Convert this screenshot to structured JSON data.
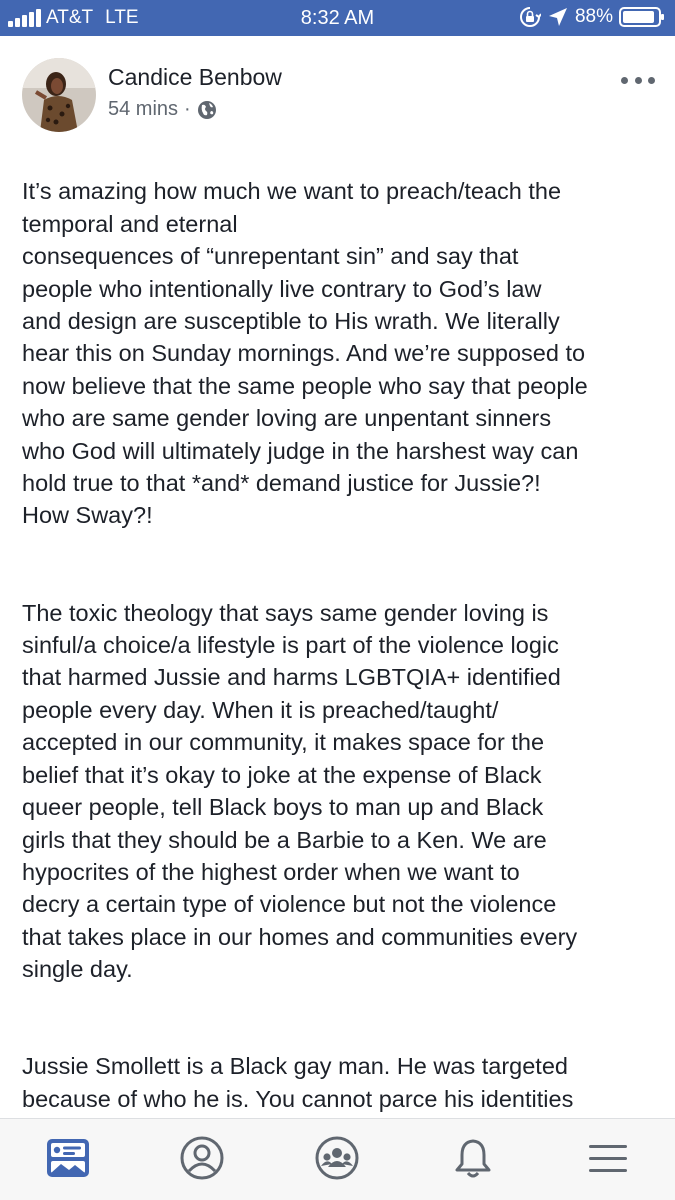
{
  "status_bar": {
    "carrier": "AT&T",
    "network": "LTE",
    "time": "8:32 AM",
    "battery": "88%"
  },
  "post": {
    "author": "Candice Benbow",
    "time_ago": "54 mins",
    "separator": "·",
    "privacy_icon": "globe-icon",
    "paragraphs": [
      "It’s amazing how much we want to preach/teach the\ntemporal and eternal\nconsequences of “unrepentant sin” and say that\npeople who intentionally live contrary to  God’s law\nand design are susceptible to His wrath. We literally\nhear this on Sunday mornings. And we’re supposed to\nnow believe that the same people who say that people\nwho are same gender loving are unpentant sinners\nwho God will ultimately judge in the harshest way can\nhold true to that *and* demand justice for Jussie?!\nHow Sway?!",
      "The toxic theology that says same gender loving is\nsinful/a choice/a lifestyle is part of the violence logic\nthat harmed Jussie and harms LGBTQIA+ identified\npeople every day. When it is preached/taught/\naccepted in our community, it makes space for the\nbelief that it’s okay to joke at the expense of Black\nqueer people, tell Black boys to man up and Black\ngirls that they should be a Barbie to a  Ken. We are\nhypocrites of the highest order when we want to\ndecry a certain type of violence but not the violence\nthat takes place in our homes and communities every\nsingle day.",
      "Jussie Smollett is a Black gay man. He was targeted\nbecause of who he is. You cannot parce his identities\nbecause you want to condemn racism but hold on to\nhomophobia. And be clear: asserting that same\ngender love is a lifestyle or a choice or sin is"
    ]
  },
  "colors": {
    "brand": "#4267b2",
    "text": "#1d2129",
    "meta": "#606770",
    "nav_icon": "#606770"
  },
  "bottom_nav": {
    "items": [
      "news-feed-icon",
      "profile-icon",
      "groups-icon",
      "notifications-icon",
      "menu-icon"
    ]
  }
}
